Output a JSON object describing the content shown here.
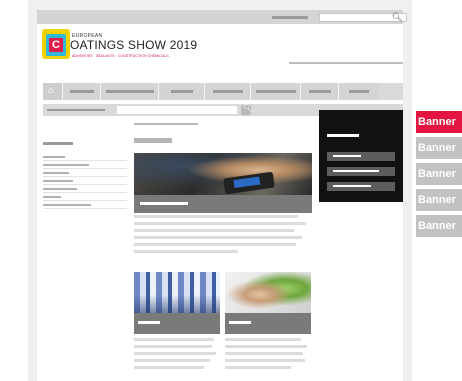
{
  "logo": {
    "eyebrow": "EUROPEAN",
    "title_letter": "C",
    "title_rest": "OATINGS SHOW 2019",
    "tagline": "ADHESIVES · SEALANTS · CONSTRUCTION CHEMICALS"
  },
  "icons": {
    "search": "search-icon",
    "home": "home-icon",
    "search_go": "search-go-icon"
  },
  "nav": {
    "item_count": 7
  },
  "banners": [
    {
      "label": "Banner",
      "active": true
    },
    {
      "label": "Banner",
      "active": false
    },
    {
      "label": "Banner",
      "active": false
    },
    {
      "label": "Banner",
      "active": false
    },
    {
      "label": "Banner",
      "active": false
    }
  ],
  "colors": {
    "accent": "#e3143f",
    "banner_inactive": "#c2c2c2",
    "logo_yellow": "#f0d200",
    "logo_cyan": "#2fb6d8",
    "dark_panel": "#111111"
  }
}
